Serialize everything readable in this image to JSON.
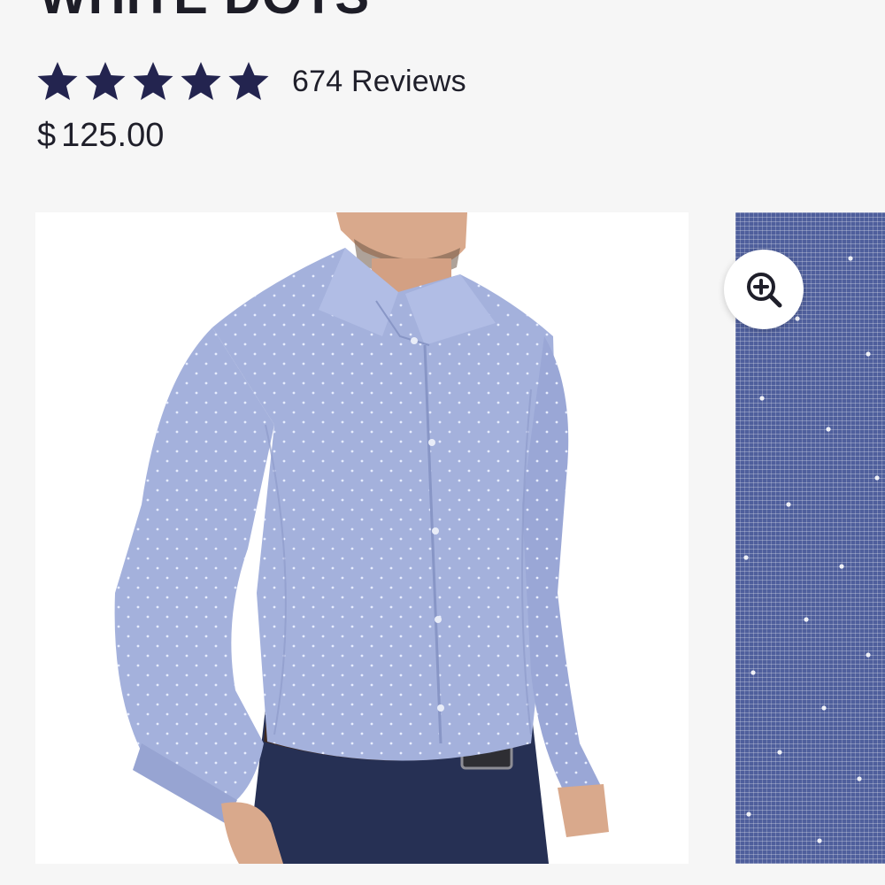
{
  "product": {
    "title": "WHITE DOTS",
    "rating": {
      "stars": 5,
      "reviews_label": "674 Reviews"
    },
    "price": {
      "currency_symbol": "$",
      "amount": "125.00"
    }
  },
  "icons": {
    "star": "star-icon",
    "zoom": "zoom-in-icon"
  },
  "colors": {
    "star": "#23244f",
    "text": "#1f1f2a",
    "shirt": "#a4b1dc",
    "pants": "#263054",
    "fabric": "#4f5f9c"
  }
}
